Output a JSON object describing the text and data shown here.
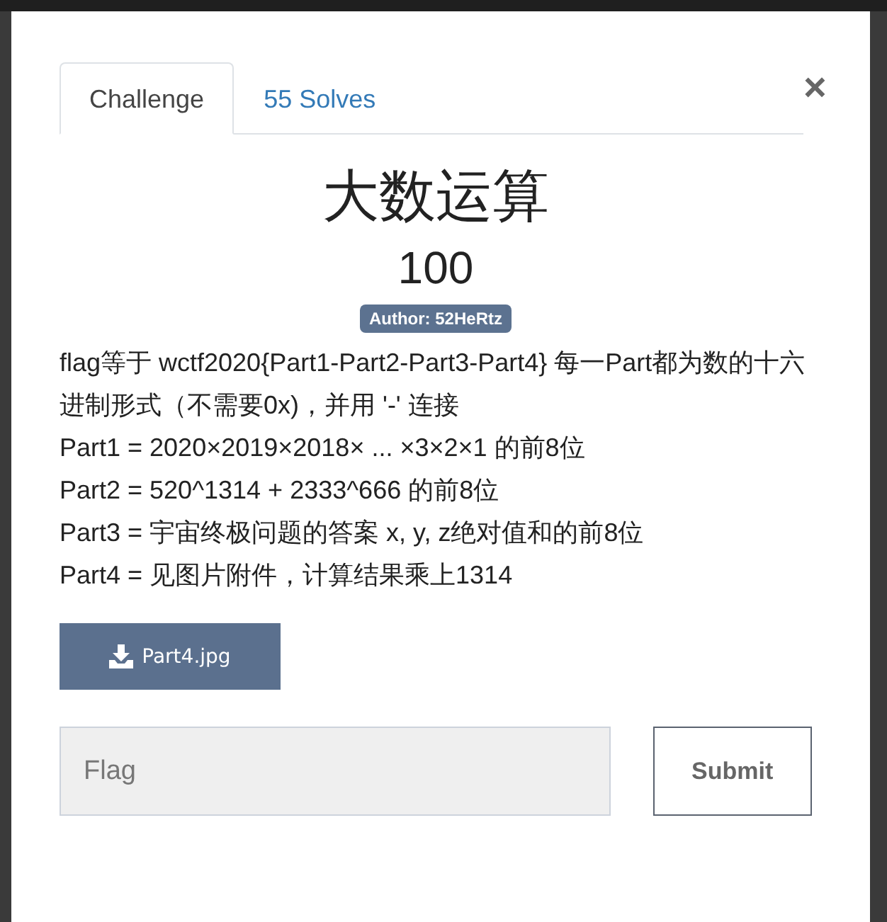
{
  "tabs": [
    {
      "label": "Challenge",
      "selected": true
    },
    {
      "label": "55 Solves",
      "selected": false
    }
  ],
  "close": "×",
  "challenge": {
    "title": "大数运算",
    "value": "100",
    "author": "Author: 52HeRtz",
    "description": [
      "flag等于 wctf2020{Part1-Part2-Part3-Part4} 每一Part都为数的十六进制形式（不需要0x)，并用 '-' 连接",
      "Part1 = 2020×2019×2018× ... ×3×2×1 的前8位",
      "Part2 = 520^1314 + 2333^666 的前8位",
      "Part3 = 宇宙终极问题的答案 x, y, z绝对值和的前8位",
      "Part4 = 见图片附件，计算结果乘上1314"
    ],
    "file": "Part4.jpg"
  },
  "flag_field": {
    "placeholder": "Flag"
  },
  "submit": "Submit"
}
